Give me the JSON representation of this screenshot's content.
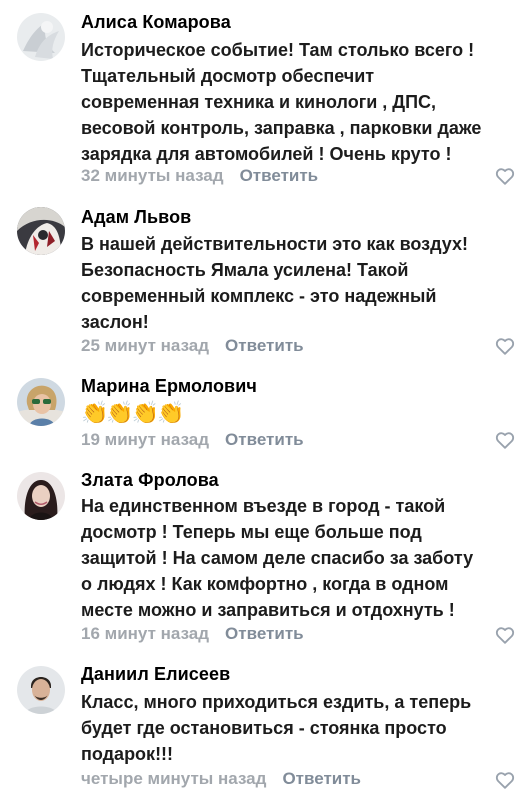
{
  "comments": [
    {
      "author": "Алиса Комарова",
      "text_lines": [
        "Историческое событие! Там столько всего !",
        "Тщательный досмотр обеспечит",
        "современная техника и кинологи , ДПС,",
        "весовой контроль, заправка , парковки даже",
        "зарядка для автомобилей ! Очень круто !"
      ],
      "time": "32 минуты назад",
      "reply_label": "Ответить"
    },
    {
      "author": "Адам Львов",
      "text_lines": [
        "В нашей действительности это как воздух!",
        "Безопасность Ямала усилена! Такой",
        "современный комплекс - это надежный",
        "заслон!"
      ],
      "time": "25 минут назад",
      "reply_label": "Ответить"
    },
    {
      "author": "Марина Ермолович",
      "text_lines": [
        "👏👏👏👏"
      ],
      "time": "19 минут назад",
      "reply_label": "Ответить"
    },
    {
      "author": "Злата Фролова",
      "text_lines": [
        "На единственном въезде в город - такой",
        "досмотр ! Теперь мы еще больше под",
        "защитой ! На самом деле спасибо за заботу",
        "о людях ! Как комфортно , когда в одном",
        "месте можно и заправиться и отдохнуть !"
      ],
      "time": "16 минут назад",
      "reply_label": "Ответить"
    },
    {
      "author": "Даниил Елисеев",
      "text_lines": [
        "Класс, много приходиться ездить, а теперь",
        "будет где остановиться - стоянка просто",
        "подарок!!!"
      ],
      "time": "четыре минуты назад",
      "reply_label": "Ответить"
    }
  ],
  "colors": {
    "meta_gray": "#a2a7ad",
    "reply_gray": "#818c99",
    "heart_outline": "#99a2ad"
  },
  "icons": {
    "like": "heart-outline-icon"
  }
}
